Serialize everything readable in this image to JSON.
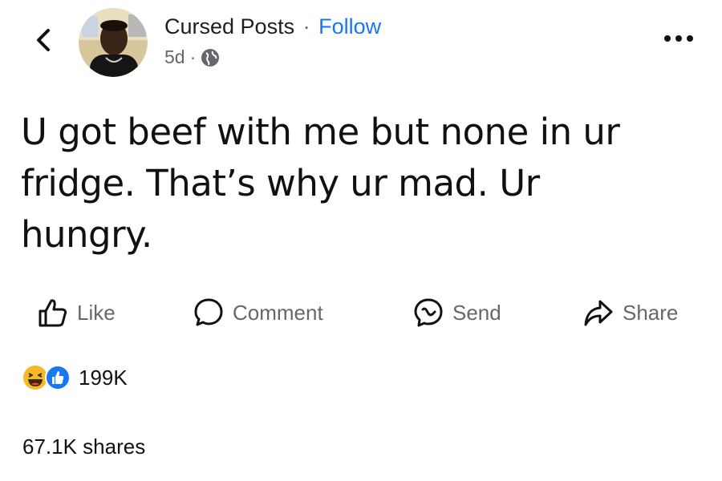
{
  "header": {
    "author": "Cursed Posts",
    "separator": "·",
    "follow_label": "Follow",
    "time": "5d",
    "meta_separator": "·",
    "privacy_icon": "globe-icon"
  },
  "post": {
    "text": "U got beef with me but none in ur fridge. That’s why ur mad. Ur hungry."
  },
  "actions": [
    {
      "label": "Like",
      "icon": "thumbs-up-icon"
    },
    {
      "label": "Comment",
      "icon": "comment-icon"
    },
    {
      "label": "Send",
      "icon": "messenger-icon"
    },
    {
      "label": "Share",
      "icon": "share-arrow-icon"
    }
  ],
  "stats": {
    "reaction_icons": [
      "haha-emoji-icon",
      "like-reaction-icon"
    ],
    "reaction_count": "199K",
    "shares": "67.1K shares"
  },
  "colors": {
    "accent": "#1877f2",
    "secondary_text": "#65676b",
    "haha_yellow": "#f7b928"
  }
}
